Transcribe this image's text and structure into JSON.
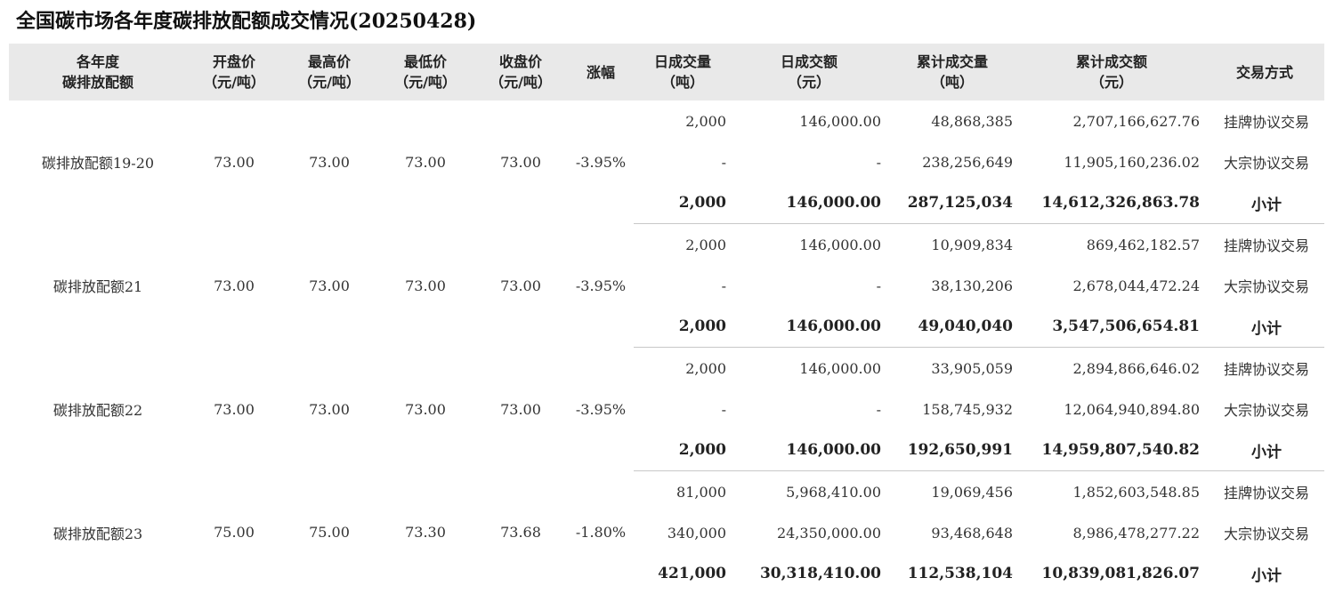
{
  "title": "全国碳市场各年度碳排放配额成交情况(20250428)",
  "headers": [
    {
      "l1": "各年度",
      "l2": "碳排放配额"
    },
    {
      "l1": "开盘价",
      "l2": "（元/吨）"
    },
    {
      "l1": "最高价",
      "l2": "（元/吨）"
    },
    {
      "l1": "最低价",
      "l2": "（元/吨）"
    },
    {
      "l1": "收盘价",
      "l2": "（元/吨）"
    },
    {
      "l1": "涨幅",
      "l2": ""
    },
    {
      "l1": "日成交量",
      "l2": "（吨）"
    },
    {
      "l1": "日成交额",
      "l2": "（元）"
    },
    {
      "l1": "累计成交量",
      "l2": "（吨）"
    },
    {
      "l1": "累计成交额",
      "l2": "（元）"
    },
    {
      "l1": "交易方式",
      "l2": ""
    }
  ],
  "groups": [
    {
      "name": "碳排放配额19-20",
      "open": "73.00",
      "high": "73.00",
      "low": "73.00",
      "close": "73.00",
      "change": "-3.95%",
      "rows": [
        {
          "vol": "2,000",
          "amt": "146,000.00",
          "cvol": "48,868,385",
          "camt": "2,707,166,627.76",
          "mode": "挂牌协议交易"
        },
        {
          "vol": "-",
          "amt": "-",
          "cvol": "238,256,649",
          "camt": "11,905,160,236.02",
          "mode": "大宗协议交易"
        },
        {
          "vol": "2,000",
          "amt": "146,000.00",
          "cvol": "287,125,034",
          "camt": "14,612,326,863.78",
          "mode": "小计"
        }
      ]
    },
    {
      "name": "碳排放配额21",
      "open": "73.00",
      "high": "73.00",
      "low": "73.00",
      "close": "73.00",
      "change": "-3.95%",
      "rows": [
        {
          "vol": "2,000",
          "amt": "146,000.00",
          "cvol": "10,909,834",
          "camt": "869,462,182.57",
          "mode": "挂牌协议交易"
        },
        {
          "vol": "-",
          "amt": "-",
          "cvol": "38,130,206",
          "camt": "2,678,044,472.24",
          "mode": "大宗协议交易"
        },
        {
          "vol": "2,000",
          "amt": "146,000.00",
          "cvol": "49,040,040",
          "camt": "3,547,506,654.81",
          "mode": "小计"
        }
      ]
    },
    {
      "name": "碳排放配额22",
      "open": "73.00",
      "high": "73.00",
      "low": "73.00",
      "close": "73.00",
      "change": "-3.95%",
      "rows": [
        {
          "vol": "2,000",
          "amt": "146,000.00",
          "cvol": "33,905,059",
          "camt": "2,894,866,646.02",
          "mode": "挂牌协议交易"
        },
        {
          "vol": "-",
          "amt": "-",
          "cvol": "158,745,932",
          "camt": "12,064,940,894.80",
          "mode": "大宗协议交易"
        },
        {
          "vol": "2,000",
          "amt": "146,000.00",
          "cvol": "192,650,991",
          "camt": "14,959,807,540.82",
          "mode": "小计"
        }
      ]
    },
    {
      "name": "碳排放配额23",
      "open": "75.00",
      "high": "75.00",
      "low": "73.30",
      "close": "73.68",
      "change": "-1.80%",
      "rows": [
        {
          "vol": "81,000",
          "amt": "5,968,410.00",
          "cvol": "19,069,456",
          "camt": "1,852,603,548.85",
          "mode": "挂牌协议交易"
        },
        {
          "vol": "340,000",
          "amt": "24,350,000.00",
          "cvol": "93,468,648",
          "camt": "8,986,478,277.22",
          "mode": "大宗协议交易"
        },
        {
          "vol": "421,000",
          "amt": "30,318,410.00",
          "cvol": "112,538,104",
          "camt": "10,839,081,826.07",
          "mode": "小计"
        }
      ]
    }
  ]
}
